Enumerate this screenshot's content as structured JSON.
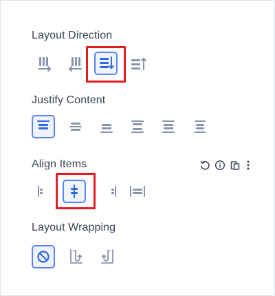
{
  "sections": {
    "layout_direction": {
      "title": "Layout Direction",
      "active_option": "column"
    },
    "justify_content": {
      "title": "Justify Content",
      "active_option": "start"
    },
    "align_items": {
      "title": "Align Items",
      "active_option": "center"
    },
    "layout_wrapping": {
      "title": "Layout Wrapping",
      "active_option": "no-wrap"
    }
  },
  "colors": {
    "text": "#3b4157",
    "icon": "#8a93ad",
    "active_icon": "#2f66e4",
    "active_bg": "#eef3fe",
    "highlight": "#e11d21"
  }
}
